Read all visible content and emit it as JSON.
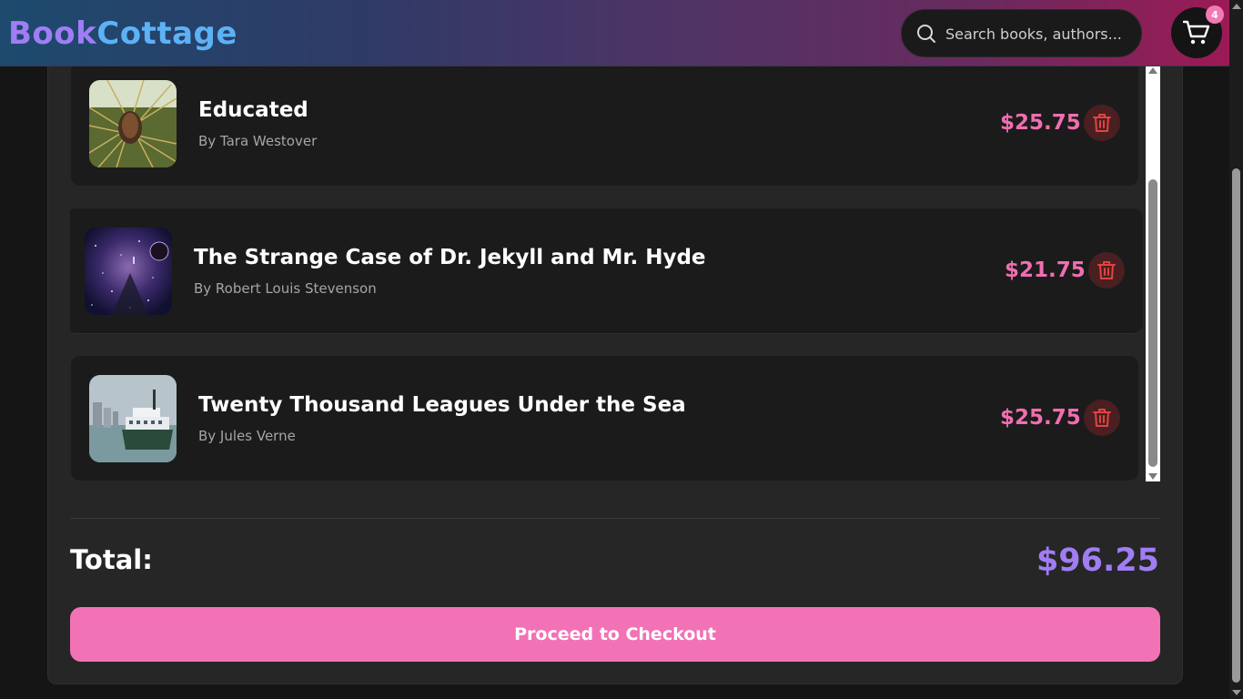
{
  "header": {
    "logo_part1": "Book",
    "logo_part2": "Cottage",
    "search_placeholder": "Search books, authors...",
    "cart_count": "4"
  },
  "cart": {
    "items": [
      {
        "title": "Educated",
        "author": "By Tara Westover",
        "price": "$25.75"
      },
      {
        "title": "The Strange Case of Dr. Jekyll and Mr. Hyde",
        "author": "By Robert Louis Stevenson",
        "price": "$21.75"
      },
      {
        "title": "Twenty Thousand Leagues Under the Sea",
        "author": "By Jules Verne",
        "price": "$25.75"
      }
    ],
    "total_label": "Total:",
    "total_value": "$96.25",
    "checkout_label": "Proceed to Checkout"
  },
  "colors": {
    "accent_pink": "#f272b6",
    "accent_purple": "#a07df5",
    "logo_blue": "#5db1f5",
    "delete_red": "#e0443f"
  },
  "icons": [
    "search-icon",
    "cart-icon",
    "trash-icon"
  ]
}
